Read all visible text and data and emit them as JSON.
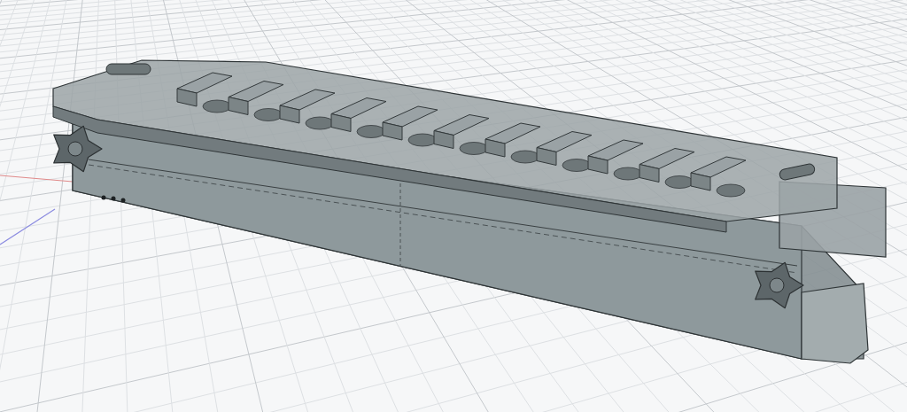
{
  "viewport": {
    "grid": {
      "visible": true
    },
    "axes": {
      "visible": true
    }
  }
}
